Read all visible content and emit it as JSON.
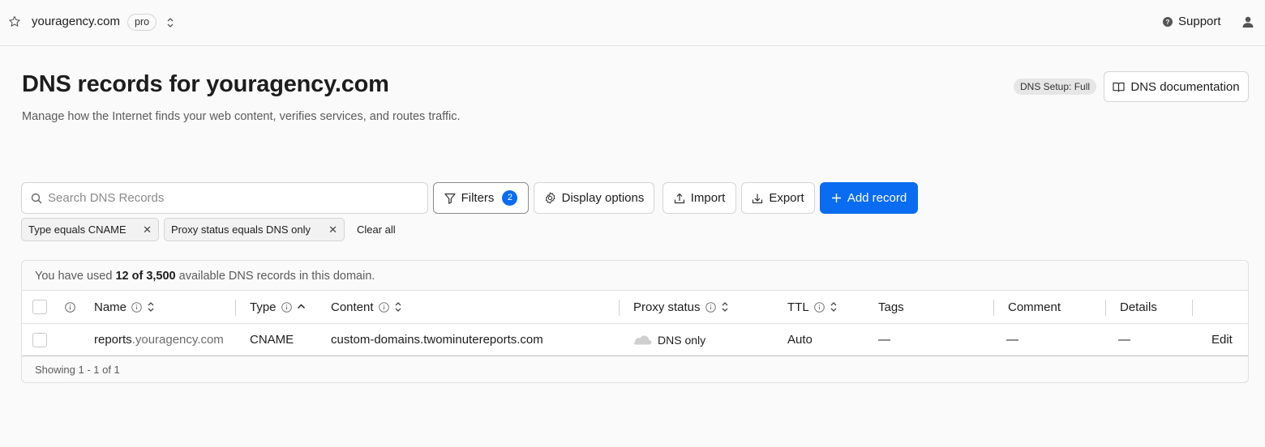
{
  "topbar": {
    "zone_name": "youragency.com",
    "plan": "pro",
    "support_label": "Support"
  },
  "header": {
    "title": "DNS records for youragency.com",
    "subtitle": "Manage how the Internet finds your web content, verifies services, and routes traffic.",
    "setup_badge": "DNS Setup: Full",
    "docs_label": "DNS documentation"
  },
  "toolbar": {
    "search_placeholder": "Search DNS Records",
    "search_value": "",
    "filters_label": "Filters",
    "filters_count": "2",
    "display_label": "Display options",
    "import_label": "Import",
    "export_label": "Export",
    "add_label": "Add record"
  },
  "active_filters": [
    {
      "label": "Type equals CNAME"
    },
    {
      "label": "Proxy status equals DNS only"
    }
  ],
  "clear_all_label": "Clear all",
  "usage": {
    "prefix": "You have used",
    "count": "12 of 3,500",
    "suffix": "available DNS records in this domain."
  },
  "table": {
    "columns": [
      "Name",
      "Type",
      "Content",
      "Proxy status",
      "TTL",
      "Tags",
      "Comment",
      "Details"
    ],
    "rows": [
      {
        "name_sub": "reports",
        "name_zone": ".youragency.com",
        "type": "CNAME",
        "content": "custom-domains.twominutereports.com",
        "proxy_status": "DNS only",
        "ttl": "Auto",
        "tags": "—",
        "comment": "—",
        "details": "—",
        "action": "Edit"
      }
    ],
    "footer": "Showing 1 - 1 of 1"
  },
  "colors": {
    "accent": "#0a6cf0",
    "border": "#d4d4d4",
    "background": "#fafafa"
  },
  "icons": [
    "star-icon",
    "chevron-up-down-icon",
    "help-circle-icon",
    "user-icon",
    "book-icon",
    "search-icon",
    "filter-icon",
    "gear-icon",
    "upload-icon",
    "download-icon",
    "plus-icon",
    "close-icon",
    "info-icon",
    "sort-icon",
    "sort-asc-icon",
    "cloud-icon"
  ]
}
